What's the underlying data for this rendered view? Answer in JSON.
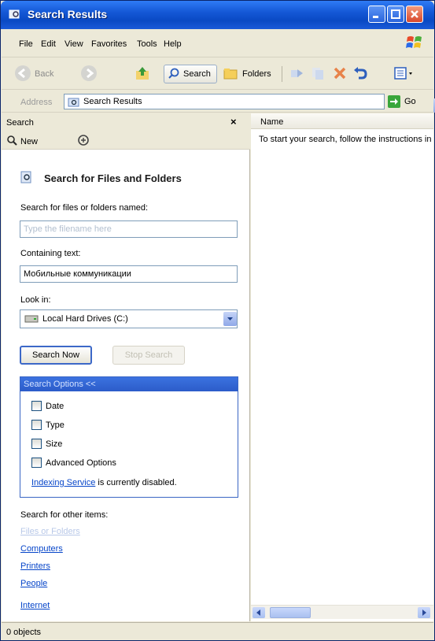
{
  "window": {
    "title": "Search Results"
  },
  "menu": [
    {
      "label": "File"
    },
    {
      "label": "Edit"
    },
    {
      "label": "View"
    },
    {
      "label": "Favorites"
    },
    {
      "label": "Tools"
    },
    {
      "label": "Help"
    }
  ],
  "toolbar": {
    "back_label": "Back",
    "search_label": "Search",
    "folders_label": "Folders"
  },
  "address": {
    "label": "Address",
    "value": "Search Results",
    "go_label": "Go"
  },
  "search_pane": {
    "header": "Search",
    "new_label": "New",
    "title": "Search for Files and Folders",
    "name_label": "Search for files or folders named:",
    "name_placeholder": "Type the filename here",
    "containing_label": "Containing text:",
    "containing_value": "Мобильные коммуникации",
    "look_in_label": "Look in:",
    "look_in_value": "Local Hard Drives (C:)",
    "search_now": "Search Now",
    "stop_search": "Stop Search",
    "options_header": "Search Options <<",
    "options": [
      {
        "label": "Date"
      },
      {
        "label": "Type"
      },
      {
        "label": "Size"
      },
      {
        "label": "Advanced Options"
      }
    ],
    "indexing_link": "Indexing Service",
    "indexing_text": "is currently disabled.",
    "other_title": "Search for other items:",
    "other_items": [
      {
        "label": "Files or Folders"
      },
      {
        "label": "Computers"
      },
      {
        "label": "Printers"
      },
      {
        "label": "People"
      },
      {
        "label": "Internet"
      }
    ]
  },
  "results": {
    "column": "Name",
    "hint": "To start your search, follow the instructions in the left pane."
  },
  "status": {
    "text": "0 objects"
  }
}
